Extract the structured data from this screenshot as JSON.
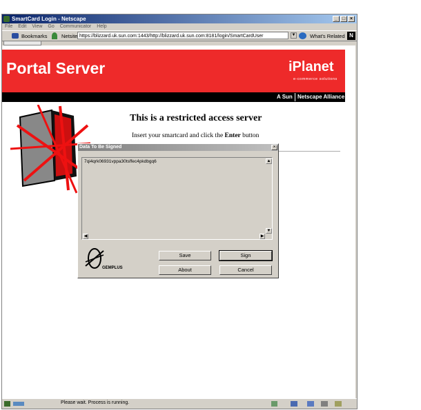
{
  "window": {
    "title": "SmartCard Login - Netscape"
  },
  "menu": [
    "File",
    "Edit",
    "View",
    "Go",
    "Communicator",
    "Help"
  ],
  "toolbar": {
    "bookmarks_label": "Bookmarks",
    "netsite_label": "Netsite:",
    "url": "https://blizzard.uk.sun.com:1443/http://blizzard.uk.sun.com:8181/login/SmartCardUser",
    "whats_related": "What's Related"
  },
  "banner": {
    "title": "Portal Server",
    "logo": "iPlanet",
    "logo_sub": "e-commerce solutions",
    "alliance_a": "A Sun",
    "alliance_b": "Netscape Alliance",
    "bg_color": "#ee2a2a"
  },
  "page": {
    "heading": "This is a restricted access server",
    "instruction_pre": "Insert your smartcard and click the ",
    "instruction_bold": "Enter",
    "instruction_post": " button"
  },
  "dialog": {
    "title": "Data To Be Signed",
    "text": "7qi4qrk06931vppa30tsffec4pkdbgq6",
    "brand": "GEMPLUS",
    "buttons": {
      "save": "Save",
      "sign": "Sign",
      "about": "About",
      "cancel": "Cancel"
    }
  },
  "status": {
    "text": "Please wait. Process is running."
  }
}
